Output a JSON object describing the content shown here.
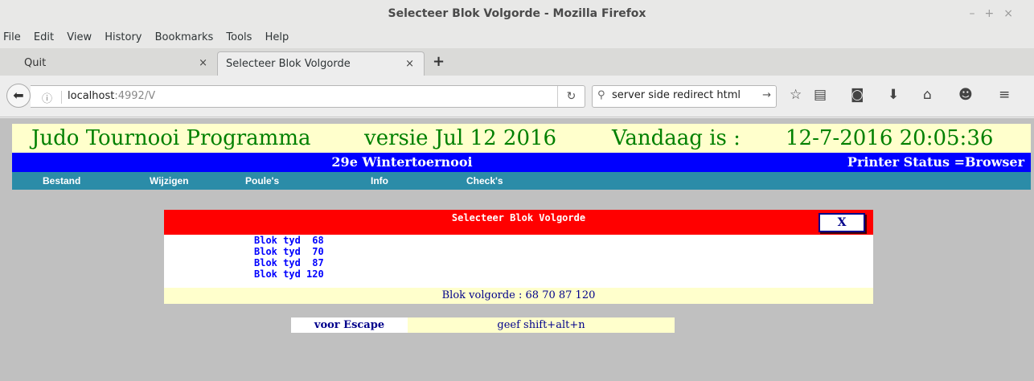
{
  "window": {
    "title": "Selecteer Blok Volgorde - Mozilla Firefox",
    "controls": [
      "–",
      "+",
      "×"
    ]
  },
  "menubar": [
    "File",
    "Edit",
    "View",
    "History",
    "Bookmarks",
    "Tools",
    "Help"
  ],
  "tabs": [
    {
      "label": "Quit",
      "close": "×"
    },
    {
      "label": "Selecteer Blok Volgorde",
      "close": "×"
    }
  ],
  "newtab": "+",
  "nav": {
    "url_host": "localhost",
    "url_rest": ":4992/V",
    "search_value": "server side redirect html"
  },
  "icons": {
    "back": "back-arrow-icon",
    "info": "info-icon",
    "reload": "reload-icon",
    "search": "search-icon",
    "go": "arrow-right-icon",
    "bookmark": "star-icon",
    "reader": "reading-list-icon",
    "pocket": "pocket-icon",
    "downloads": "download-icon",
    "home": "home-icon",
    "chat": "chat-icon",
    "menu": "hamburger-icon"
  },
  "page": {
    "header": {
      "app": "Judo Tournooi Programma",
      "version": "versie Jul 12 2016",
      "today_label": "Vandaag is :",
      "datetime": "12-7-2016 20:05:36"
    },
    "tournament": "29e Wintertoernooi",
    "printer_status": "Printer Status =Browser",
    "menu": [
      "Bestand",
      "Wijzigen",
      "Poule's",
      "Info",
      "Check's"
    ],
    "dialog": {
      "title": "Selecteer Blok Volgorde",
      "close_label": "X",
      "items": [
        "Blok tyd  68",
        "Blok tyd  70",
        "Blok tyd  87",
        "Blok tyd 120"
      ],
      "summary": "Blok volgorde : 68 70 87 120"
    },
    "escape": {
      "label": "voor Escape",
      "hint": "geef shift+alt+n"
    }
  },
  "colors": {
    "header_bg": "#ffffcc",
    "header_text": "#008000",
    "tournament_bar": "#0000ff",
    "menu_bar": "#2b8ca8",
    "dialog_head": "#ff0000",
    "blok_text": "#0000ff",
    "content_bg": "#c0c0c0"
  }
}
